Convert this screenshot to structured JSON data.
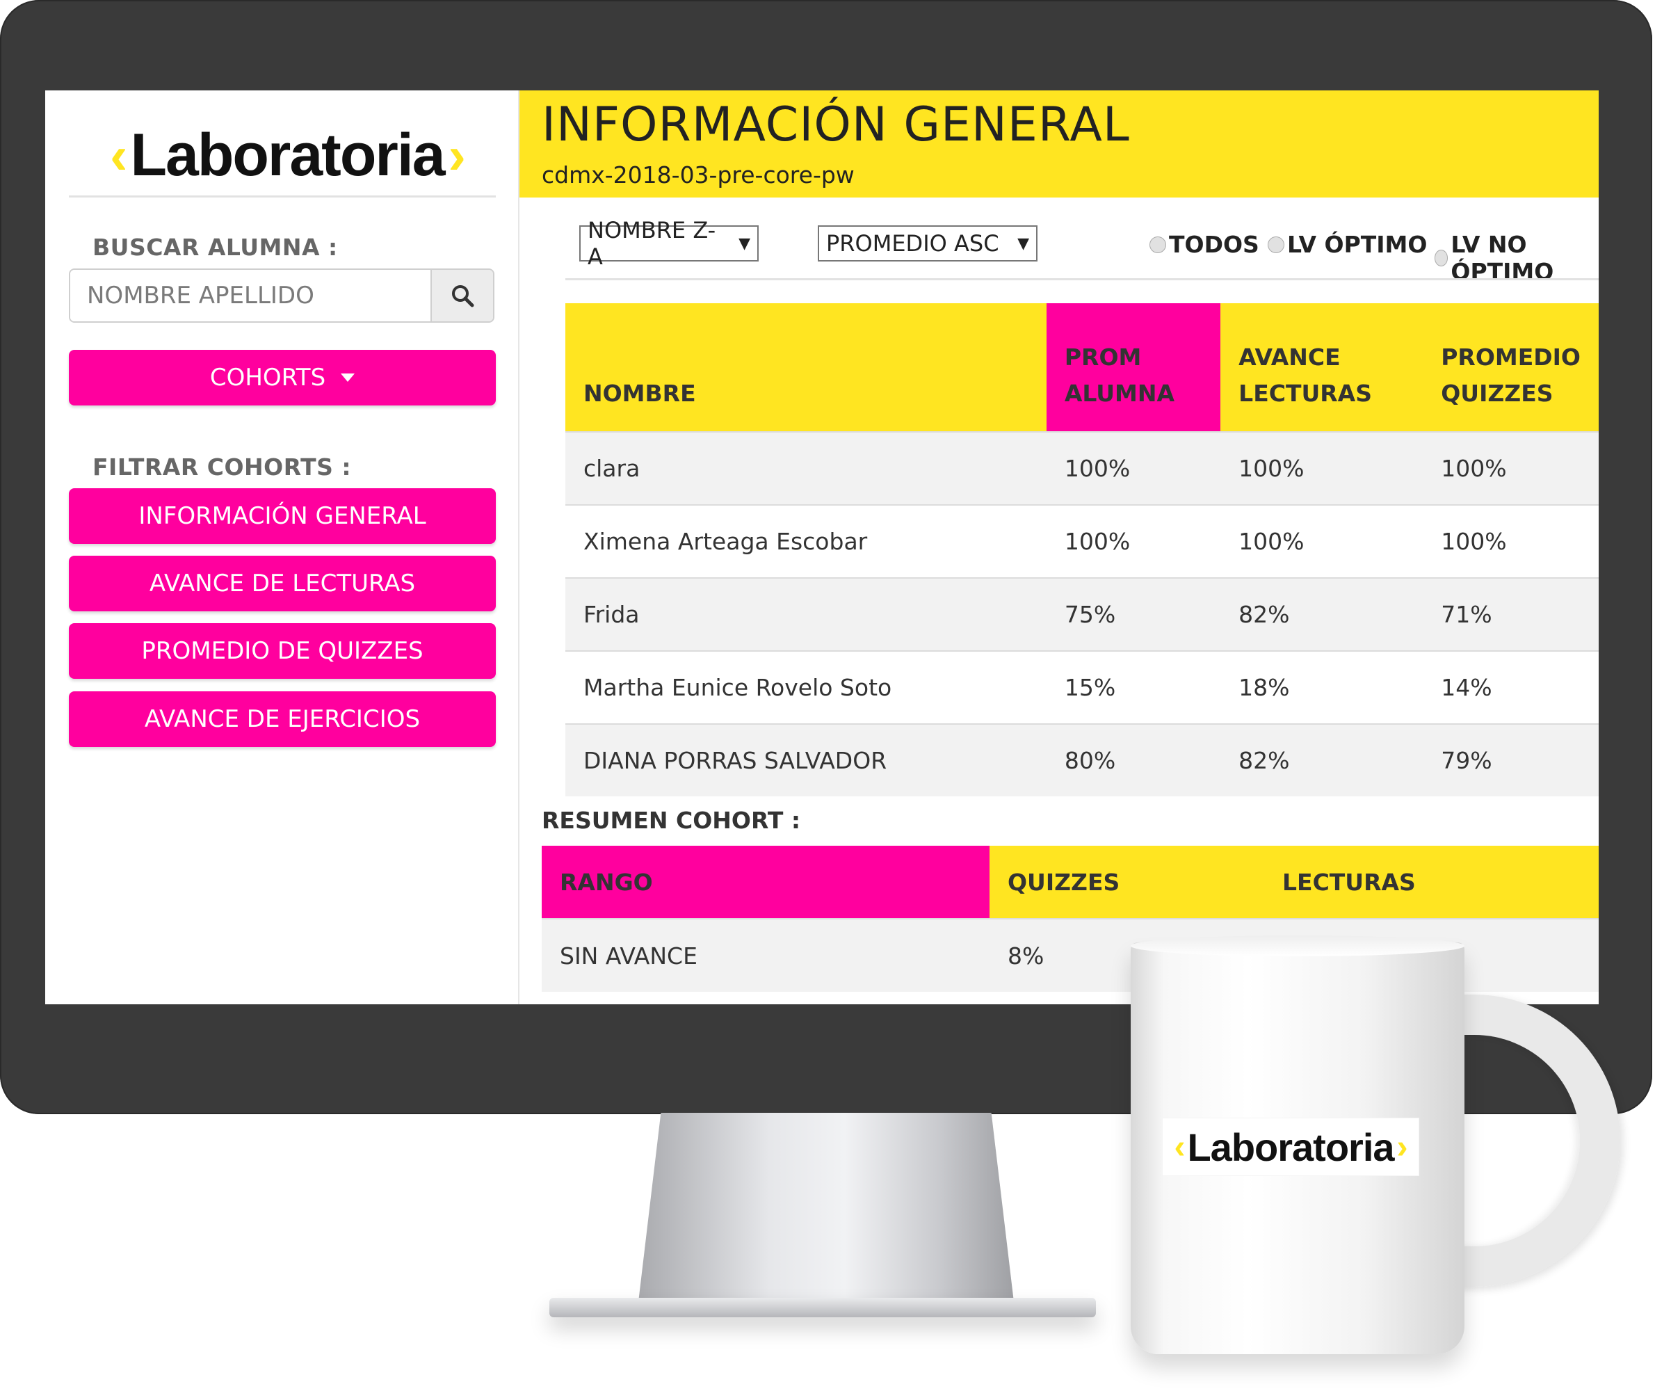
{
  "brand": {
    "logo_text": "Laboratoria",
    "chevron_left": "‹",
    "chevron_right": "›",
    "colors": {
      "pink": "#ff009e",
      "yellow": "#ffe521",
      "bezel": "#3a3a3a"
    }
  },
  "sidebar": {
    "search_label": "BUSCAR ALUMNA :",
    "search_placeholder": "NOMBRE APELLIDO",
    "search_icon": "search-icon",
    "cohorts_button": "COHORTS",
    "filter_label": "FILTRAR COHORTS :",
    "nav": [
      {
        "label": "INFORMACIÓN GENERAL"
      },
      {
        "label": "AVANCE DE LECTURAS"
      },
      {
        "label": "PROMEDIO DE QUIZZES"
      },
      {
        "label": "AVANCE DE EJERCICIOS"
      }
    ]
  },
  "header": {
    "title": "INFORMACIÓN GENERAL",
    "cohort": "cdmx-2018-03-pre-core-pw"
  },
  "controls": {
    "sort_name": "NOMBRE Z-A",
    "sort_average": "PROMEDIO ASC",
    "radios": [
      {
        "label": "TODOS"
      },
      {
        "label": "LV ÓPTIMO"
      },
      {
        "label": "LV NO ÓPTIMO"
      }
    ]
  },
  "students_table": {
    "headers": {
      "name": "NOMBRE",
      "prom_line1": "PROM",
      "prom_line2": "ALUMNA",
      "reading_line1": "AVANCE",
      "reading_line2": "LECTURAS",
      "quiz_line1": "PROMEDIO",
      "quiz_line2": "QUIZZES"
    },
    "rows": [
      {
        "name": "clara",
        "prom": "100%",
        "reading": "100%",
        "quizzes": "100%"
      },
      {
        "name": "Ximena Arteaga Escobar",
        "prom": "100%",
        "reading": "100%",
        "quizzes": "100%"
      },
      {
        "name": "Frida",
        "prom": "75%",
        "reading": "82%",
        "quizzes": "71%"
      },
      {
        "name": "Martha Eunice Rovelo Soto",
        "prom": "15%",
        "reading": "18%",
        "quizzes": "14%"
      },
      {
        "name": "DIANA PORRAS SALVADOR",
        "prom": "80%",
        "reading": "82%",
        "quizzes": "79%"
      }
    ]
  },
  "summary": {
    "label": "RESUMEN COHORT :",
    "headers": {
      "range": "RANGO",
      "quizzes": "QUIZZES",
      "readings": "LECTURAS"
    },
    "rows": [
      {
        "range": "SIN AVANCE",
        "quizzes": "8%"
      }
    ]
  },
  "mug": {
    "logo_text": "Laboratoria"
  }
}
